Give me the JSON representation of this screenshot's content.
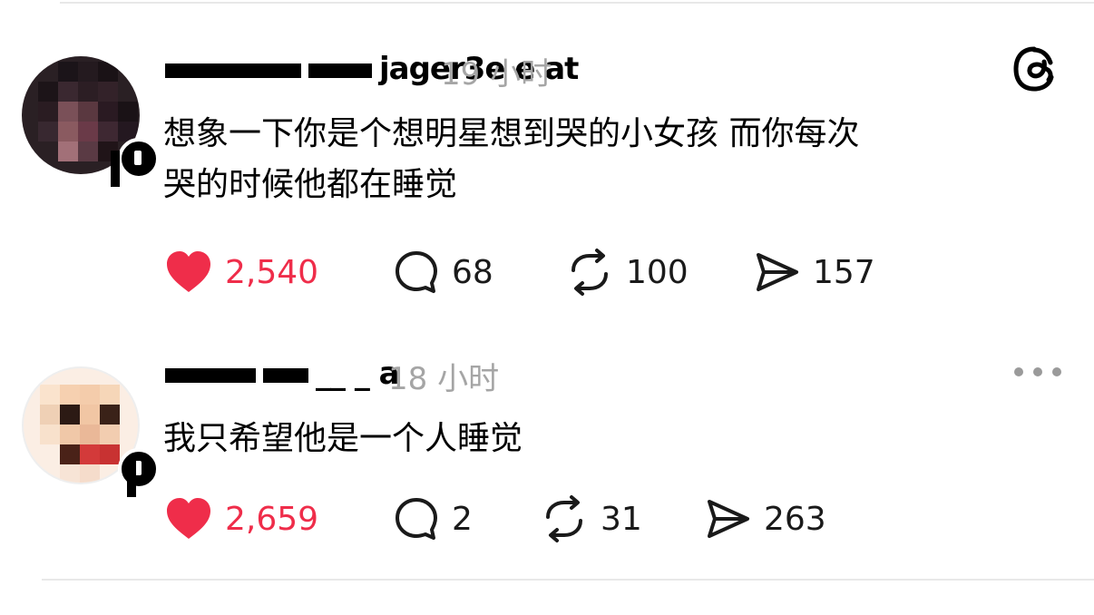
{
  "colors": {
    "like_red": "#ef2d4a",
    "muted_gray": "#a5a5a5",
    "text": "#000000"
  },
  "header": {
    "logo_icon": "threads-logo-icon"
  },
  "posts": [
    {
      "username": "jager3e e at",
      "time": "19 小时",
      "text_line_1": "想象一下你是个想明星想到哭的小女孩  而你每次",
      "text_line_2": "哭的时候他都在睡觉",
      "likes": "2,540",
      "comments": "68",
      "reposts": "100",
      "shares": "157"
    },
    {
      "username": "__ _ a",
      "time": "18 小时",
      "text_line_1": "我只希望他是一个人睡觉",
      "likes": "2,659",
      "comments": "2",
      "reposts": "31",
      "shares": "263",
      "more_icon": "more-options-icon"
    }
  ]
}
